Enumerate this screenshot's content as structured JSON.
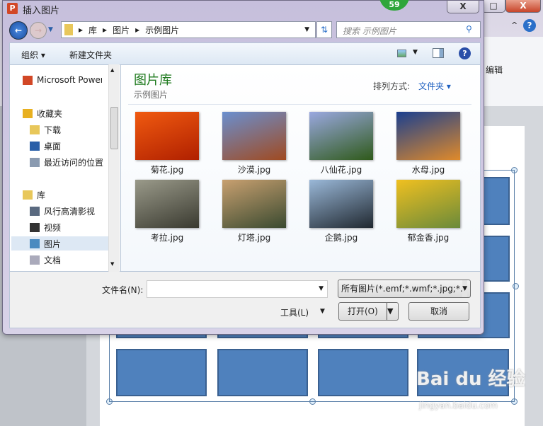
{
  "dialog": {
    "title": "插入图片",
    "close": "X",
    "badge": "59"
  },
  "background": {
    "window_restore": "□",
    "window_close": "X",
    "help": "?",
    "ribbon_edit": "编辑",
    "watermark": "Bai du 经验",
    "watermark_url": "jingyan.baidu.com"
  },
  "address": {
    "crumbs": [
      "库",
      "图片",
      "示例图片"
    ]
  },
  "search": {
    "placeholder": "搜索 示例图片"
  },
  "toolbar": {
    "organize": "组织 ▾",
    "new_folder": "新建文件夹"
  },
  "nav": {
    "items": [
      {
        "label": "Microsoft PowerPoint",
        "icon": "ppt-icon"
      },
      {
        "label": "收藏夹",
        "icon": "star-icon"
      },
      {
        "label": "下载",
        "icon": "download-folder-icon"
      },
      {
        "label": "桌面",
        "icon": "desktop-icon"
      },
      {
        "label": "最近访问的位置",
        "icon": "recent-icon"
      },
      {
        "label": "库",
        "icon": "library-icon"
      },
      {
        "label": "风行高清影视",
        "icon": "video-library-icon"
      },
      {
        "label": "视频",
        "icon": "video-icon"
      },
      {
        "label": "图片",
        "icon": "pictures-icon",
        "selected": true
      },
      {
        "label": "文档",
        "icon": "documents-icon"
      }
    ]
  },
  "content": {
    "title": "图片库",
    "subtitle": "示例图片",
    "sort_label": "排列方式:",
    "sort_value": "文件夹 ▾",
    "title_color": "#1e7a1e",
    "files": [
      {
        "name": "菊花.jpg",
        "colors": [
          "#f05a10",
          "#b02000"
        ]
      },
      {
        "name": "沙漠.jpg",
        "colors": [
          "#6a8fcf",
          "#a04a20"
        ]
      },
      {
        "name": "八仙花.jpg",
        "colors": [
          "#9aa8e0",
          "#2f5a1a"
        ]
      },
      {
        "name": "水母.jpg",
        "colors": [
          "#1a3f8f",
          "#e08a2a"
        ]
      },
      {
        "name": "考拉.jpg",
        "colors": [
          "#9a9a8a",
          "#3a3a30"
        ]
      },
      {
        "name": "灯塔.jpg",
        "colors": [
          "#c8a070",
          "#3a4a30"
        ]
      },
      {
        "name": "企鹅.jpg",
        "colors": [
          "#9ab8d8",
          "#202830"
        ]
      },
      {
        "name": "郁金香.jpg",
        "colors": [
          "#f0c020",
          "#6a8a3a"
        ]
      }
    ]
  },
  "bottom": {
    "filename_label": "文件名(N):",
    "filename_value": "",
    "filter": "所有图片(*.emf;*.wmf;*.jpg;*.j",
    "tools": "工具(L)",
    "open": "打开(O)",
    "cancel": "取消"
  }
}
